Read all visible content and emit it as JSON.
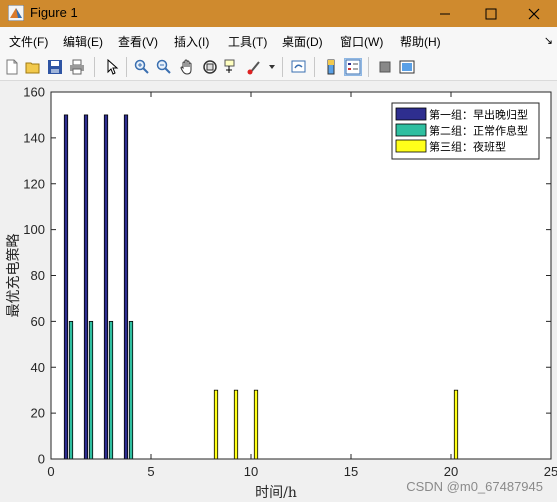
{
  "window": {
    "title": "Figure 1",
    "icon": "matlab-figure-icon",
    "controls": [
      "minimize-icon",
      "maximize-icon",
      "close-icon"
    ],
    "title_bar_color": "#cf8a2e"
  },
  "menu": {
    "items": [
      {
        "label": "文件(F)"
      },
      {
        "label": "编辑(E)"
      },
      {
        "label": "查看(V)"
      },
      {
        "label": "插入(I)"
      },
      {
        "label": "工具(T)"
      },
      {
        "label": "桌面(D)"
      },
      {
        "label": "窗口(W)"
      },
      {
        "label": "帮助(H)"
      }
    ],
    "dock_arrow": "↘"
  },
  "toolbar": {
    "icons": [
      "new-figure-icon",
      "open-file-icon",
      "save-icon",
      "print-icon",
      "edit-plot-arrow-icon",
      "zoom-in-icon",
      "zoom-out-icon",
      "pan-hand-icon",
      "rotate-3d-icon",
      "data-cursor-icon",
      "brush-icon",
      "link-plot-icon",
      "insert-colorbar-icon",
      "insert-legend-icon",
      "hide-plot-tools-icon",
      "show-plot-tools-icon"
    ],
    "active": "insert-legend-icon"
  },
  "chart_data": {
    "type": "bar",
    "xlabel": "时间/h",
    "ylabel": "最优充电策略",
    "xlim": [
      0,
      25
    ],
    "ylim": [
      0,
      160
    ],
    "xticks": [
      "0",
      "5",
      "10",
      "15",
      "20",
      "25"
    ],
    "yticks": [
      "0",
      "20",
      "40",
      "60",
      "80",
      "100",
      "120",
      "140",
      "160"
    ],
    "grid": false,
    "legend_position": "top-right",
    "series": [
      {
        "name": "第一组：早出晚归型",
        "color": "#2e2e8f",
        "x": [
          0.75,
          1.75,
          2.75,
          3.75
        ],
        "values": [
          150,
          150,
          150,
          150
        ]
      },
      {
        "name": "第二组：正常作息型",
        "color": "#2fbfa0",
        "x": [
          1,
          2,
          3,
          4
        ],
        "values": [
          60,
          60,
          60,
          60
        ]
      },
      {
        "name": "第三组：夜班型",
        "color": "#ffff1a",
        "x": [
          8.25,
          9.25,
          10.25,
          20.25
        ],
        "values": [
          30,
          30,
          30,
          30
        ]
      }
    ]
  },
  "watermark": "CSDN @m0_67487945"
}
